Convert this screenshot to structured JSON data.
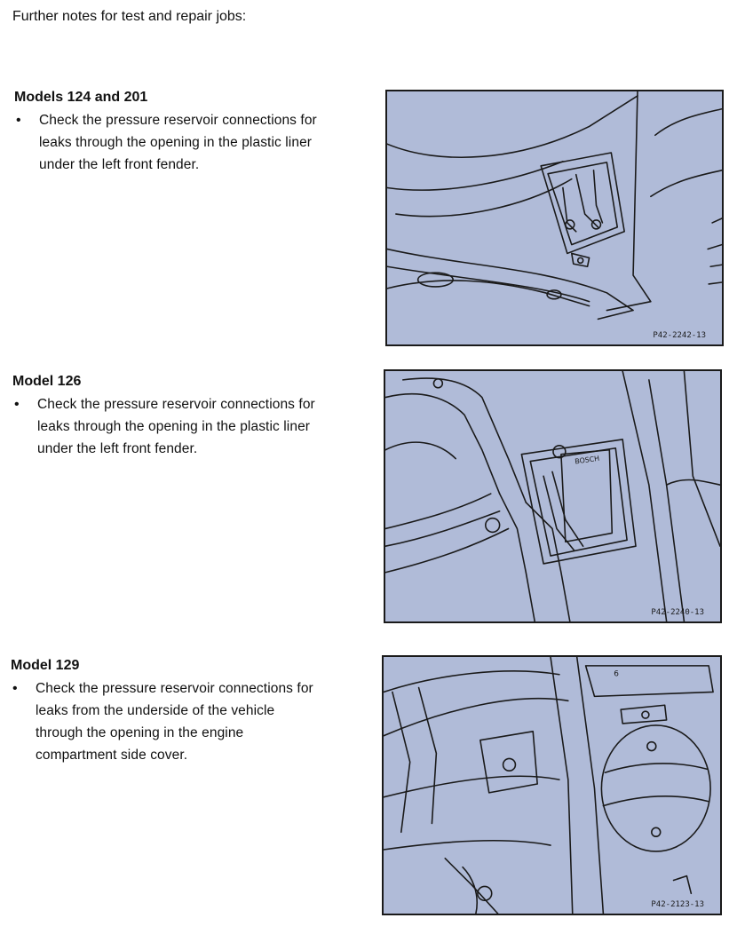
{
  "intro": "Further notes for test and repair jobs:",
  "sections": [
    {
      "heading": "Models 124 and 201",
      "bullet": "•",
      "text": "Check the pressure reservoir connections for\nleaks through the opening in the plastic liner\nunder the left front fender.",
      "figure_id": "P42-2242-13"
    },
    {
      "heading": "Model 126",
      "bullet": "•",
      "text": "Check the pressure reservoir connections for\nleaks through the opening in the plastic liner\nunder the left front fender.",
      "figure_id": "P42-2240-13",
      "figure_label": "BOSCH"
    },
    {
      "heading": "Model 129",
      "bullet": "•",
      "text": "Check the pressure reservoir connections for\nleaks from the underside of the vehicle\nthrough the opening in the engine\ncompartment side cover.",
      "figure_id": "P42-2123-13"
    }
  ],
  "colors": {
    "illustration_bg": "#b0bbd8",
    "line": "#1a1a1a"
  }
}
